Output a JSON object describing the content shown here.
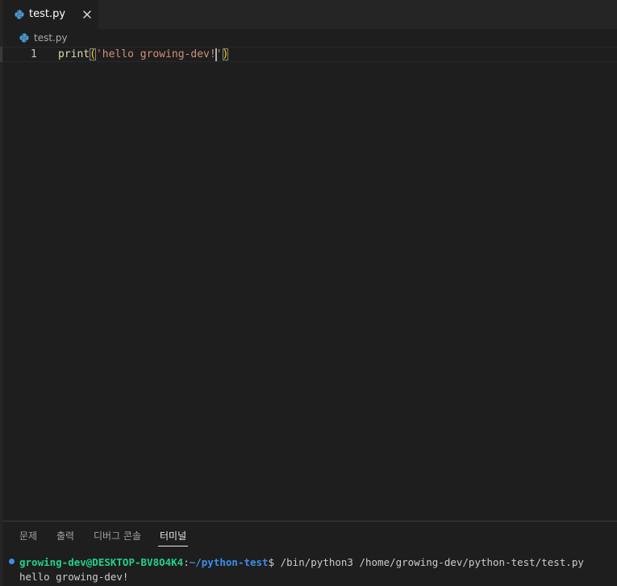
{
  "tab": {
    "label": "test.py",
    "close_icon": "close-icon",
    "file_icon": "python-icon"
  },
  "breadcrumb": {
    "label": "test.py",
    "icon": "python-icon"
  },
  "editor": {
    "line_number": "1",
    "tokens": {
      "fn": "print",
      "open_paren": "(",
      "quote_open": "'",
      "string": "hello growing-dev!",
      "quote_close": "'",
      "close_paren": ")"
    }
  },
  "panel": {
    "tabs": [
      {
        "label": "문제"
      },
      {
        "label": "출력"
      },
      {
        "label": "디버그 콘솔"
      },
      {
        "label": "터미널",
        "active": true
      }
    ]
  },
  "terminal": {
    "user_host": "growing-dev@DESKTOP-BV8O4K4",
    "colon": ":",
    "path": "~/python-test",
    "dollar": "$",
    "command": " /bin/python3 /home/growing-dev/python-test/test.py",
    "output": "hello growing-dev!"
  },
  "colors": {
    "background": "#1e1e1e",
    "tab_bar": "#252526",
    "terminal_user": "#23d18b",
    "terminal_path": "#3b8eea",
    "string": "#ce9178",
    "function": "#dcdcaa",
    "bracket": "#ffd700"
  }
}
